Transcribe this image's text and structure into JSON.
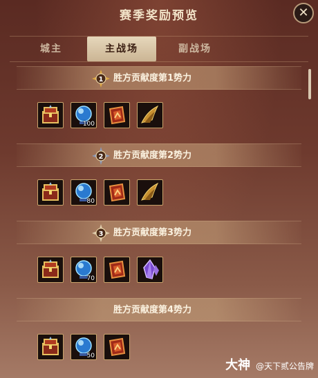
{
  "dialog": {
    "title": "赛季奖励预览",
    "close_label": "✕"
  },
  "tabs": [
    {
      "label": "城主",
      "active": false
    },
    {
      "label": "主战场",
      "active": true
    },
    {
      "label": "副战场",
      "active": false
    }
  ],
  "rewards": [
    {
      "rank": "1",
      "label": "胜方贡献度第1势力",
      "items": [
        {
          "icon": "treasure-chest-icon",
          "qty": ""
        },
        {
          "icon": "blue-orb-icon",
          "qty": "100"
        },
        {
          "icon": "red-token-icon",
          "qty": ""
        },
        {
          "icon": "golden-wing-icon",
          "qty": ""
        }
      ]
    },
    {
      "rank": "2",
      "label": "胜方贡献度第2势力",
      "items": [
        {
          "icon": "treasure-chest-icon",
          "qty": ""
        },
        {
          "icon": "blue-orb-icon",
          "qty": "80"
        },
        {
          "icon": "red-token-icon",
          "qty": ""
        },
        {
          "icon": "golden-wing-icon",
          "qty": ""
        }
      ]
    },
    {
      "rank": "3",
      "label": "胜方贡献度第3势力",
      "items": [
        {
          "icon": "treasure-chest-icon",
          "qty": ""
        },
        {
          "icon": "blue-orb-icon",
          "qty": "70"
        },
        {
          "icon": "red-token-icon",
          "qty": ""
        },
        {
          "icon": "purple-crystal-icon",
          "qty": ""
        }
      ]
    },
    {
      "rank": "",
      "label": "胜方贡献度第4势力",
      "items": [
        {
          "icon": "treasure-chest-icon",
          "qty": ""
        },
        {
          "icon": "blue-orb-icon",
          "qty": "50"
        },
        {
          "icon": "red-token-icon",
          "qty": ""
        }
      ]
    }
  ],
  "watermark": {
    "logo": "大神",
    "text": "@天下贰公告牌"
  },
  "colors": {
    "gold_frame": "#c9a46b",
    "banner_text": "#fbf2e0",
    "active_tab_bg": "#e6d7bb"
  }
}
